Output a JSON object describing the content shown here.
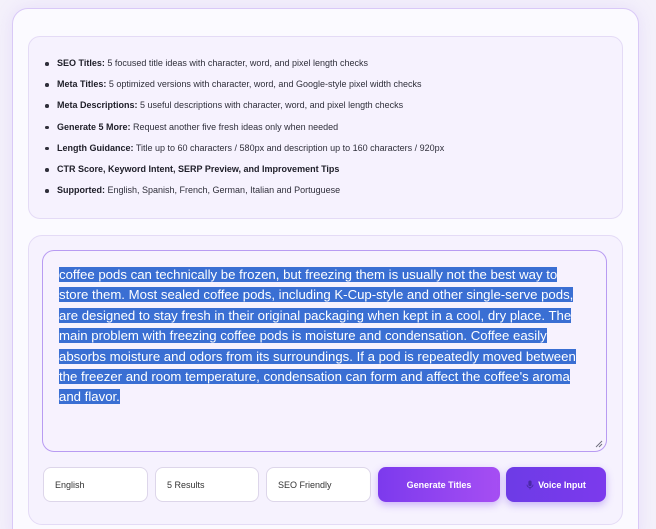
{
  "features": [
    {
      "label": "SEO Titles:",
      "text": " 5 focused title ideas with character, word, and pixel length checks"
    },
    {
      "label": "Meta Titles:",
      "text": " 5 optimized versions with character, word, and Google-style pixel width checks"
    },
    {
      "label": "Meta Descriptions:",
      "text": " 5 useful descriptions with character, word, and pixel length checks"
    },
    {
      "label": "Generate 5 More:",
      "text": " Request another five fresh ideas only when needed"
    },
    {
      "label": "Length Guidance:",
      "text": " Title up to 60 characters / 580px and description up to 160 characters / 920px"
    },
    {
      "label": "CTR Score, Keyword Intent, SERP Preview, and Improvement Tips",
      "text": ""
    },
    {
      "label": "Supported:",
      "text": " English, Spanish, French, German, Italian and Portuguese"
    }
  ],
  "input": {
    "text": "coffee pods can technically be frozen, but freezing them is usually not the best way to store them. Most sealed coffee pods, including K-Cup-style and other single-serve pods, are designed to stay fresh in their original packaging when kept in a cool, dry place. The main problem with freezing coffee pods is moisture and condensation. Coffee easily absorbs moisture and odors from its surroundings. If a pod is repeatedly moved between the freezer and room temperature, condensation can form and affect the coffee's aroma and flavor."
  },
  "controls": {
    "language": "English",
    "results": "5 Results",
    "style": "SEO Friendly",
    "generate_label": "Generate Titles",
    "voice_label": "Voice Input",
    "voice_icon": "microphone-icon"
  },
  "colors": {
    "accent": "#7c3aed",
    "selection": "#3a6fd3"
  }
}
